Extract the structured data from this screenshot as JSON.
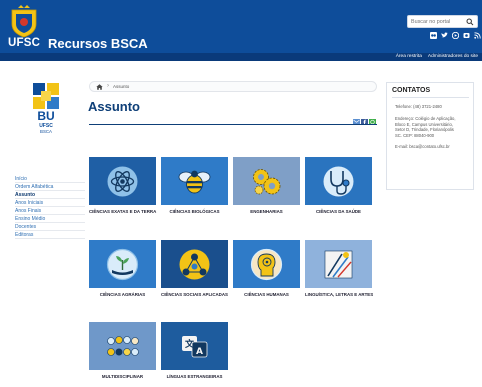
{
  "header": {
    "brand": "UFSC",
    "site_name": "Recursos BSCA",
    "search_placeholder": "Buscar no portal",
    "social_icons": [
      "flickr-icon",
      "twitter-icon",
      "youtube-icon",
      "instagram-icon",
      "rss-icon"
    ],
    "top_links": [
      "Área restrita",
      "Administradores do site"
    ]
  },
  "sidebar": {
    "logo_text": "BU",
    "logo_sub1": "UFSC",
    "logo_sub2": "BSCA",
    "items": [
      {
        "label": "Início"
      },
      {
        "label": "Ordem Alfabética"
      },
      {
        "label": "Assunto",
        "active": true
      },
      {
        "label": "Anos Iniciais"
      },
      {
        "label": "Anos Finais"
      },
      {
        "label": "Ensino Médio"
      },
      {
        "label": "Docentes"
      },
      {
        "label": "Editoras"
      }
    ]
  },
  "breadcrumb": {
    "current": "Assunto"
  },
  "main": {
    "title": "Assunto",
    "categories": [
      {
        "label": "CIÊNCIAS EXATAS E DA TERRA",
        "color": "#1f5fa5",
        "icon": "atom-icon"
      },
      {
        "label": "CIÊNCIAS BIOLÓGICAS",
        "color": "#2f7bc8",
        "icon": "bee-icon"
      },
      {
        "label": "ENGENHARIAS",
        "color": "#7f9fc7",
        "icon": "gears-icon"
      },
      {
        "label": "CIÊNCIAS DA SAÚDE",
        "color": "#2a74bf",
        "icon": "stethoscope-icon"
      },
      {
        "label": "CIÊNCIAS AGRÁRIAS",
        "color": "#2f7bc8",
        "icon": "plant-icon"
      },
      {
        "label": "CIÊNCIAS SOCIAIS APLICADAS",
        "color": "#1a4f8d",
        "icon": "network-icon"
      },
      {
        "label": "CIÊNCIAS HUMANAS",
        "color": "#2f7bc8",
        "icon": "human-head-icon"
      },
      {
        "label": "LINGUÍSTICA, LETRAS E ARTES",
        "color": "#8fb2dc",
        "icon": "art-brushes-icon"
      },
      {
        "label": "MULTIDISCIPLINAR",
        "color": "#6f98c9",
        "icon": "multi-icons-icon"
      },
      {
        "label": "LÍNGUAS ESTRANGEIRAS",
        "color": "#1e5c9e",
        "icon": "translate-icon"
      }
    ]
  },
  "contact": {
    "title": "CONTATOS",
    "phone": "Telefone: (48) 3721-2480",
    "address_1": "Endereço: Colégio de Aplicação,",
    "address_2": "Bloco E, Campus Universitário,",
    "address_3": "Setor D, Trindade, Florianópolis",
    "address_4": "SC. CEP: 88040-900",
    "email": "E-mail: bsca@contato.ufsc.br"
  }
}
